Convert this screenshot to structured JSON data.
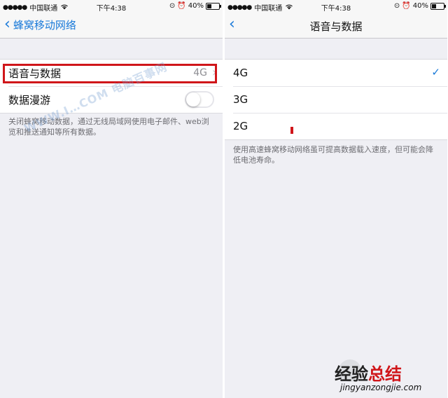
{
  "status_bar": {
    "signal_dots": "●●●●●",
    "carrier": "中国联通",
    "time": "下午4:38",
    "battery": "40%"
  },
  "left": {
    "nav": {
      "back_label": "蜂窝移动网络"
    },
    "voice_data": {
      "label": "语音与数据",
      "value": "4G"
    },
    "roaming": {
      "label": "数据漫游",
      "enabled": false
    },
    "footnote": "关闭蜂窝移动数据，通过无线局域网使用电子邮件、web浏览和推送通知等所有数据。"
  },
  "right": {
    "nav": {
      "title": "语音与数据"
    },
    "options": [
      {
        "label": "4G",
        "selected": true
      },
      {
        "label": "3G",
        "selected": false
      },
      {
        "label": "2G",
        "selected": false
      }
    ],
    "footnote": "使用高速蜂窝移动网络虽可提高数据载入速度，但可能会降低电池寿命。"
  },
  "watermarks": {
    "diagonal": "WWW.I…COM 电脑百事网",
    "brand_main": "经验",
    "brand_accent": "总结",
    "brand_url": "jingyanzongjie.com"
  },
  "colors": {
    "accent": "#1a7ad9",
    "highlight": "#d0161a",
    "background": "#efeff4"
  }
}
